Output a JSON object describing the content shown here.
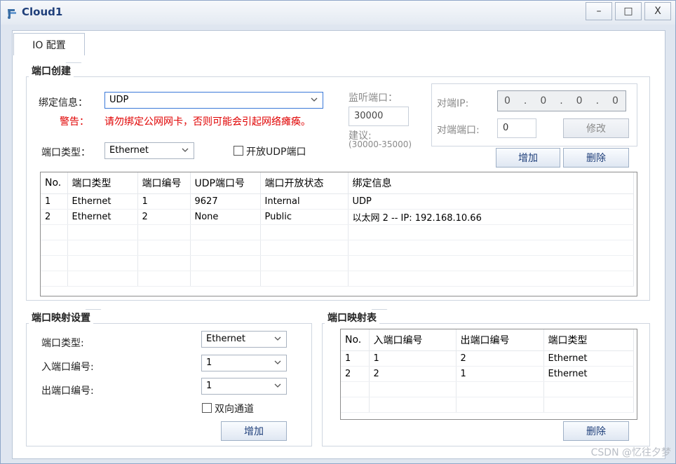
{
  "window": {
    "title": "Cloud1",
    "minimize_glyph": "–",
    "maximize_glyph": "□",
    "close_glyph": "X"
  },
  "tab": {
    "label": "IO 配置"
  },
  "create": {
    "title": "端口创建",
    "bind_label": "绑定信息：",
    "bind_value": "UDP",
    "warning_label": "警告：",
    "warning_text": "请勿绑定公网网卡，否则可能会引起网络瘫痪。",
    "port_type_label": "端口类型：",
    "port_type_value": "Ethernet",
    "open_udp_label": "开放UDP端口",
    "listen_label": "监听端口：",
    "listen_value": "30000",
    "suggest_label": "建议:",
    "suggest_range": "(30000-35000)",
    "peer_ip_label": "对端IP:",
    "peer_ip_octets": [
      "0",
      "0",
      "0",
      "0"
    ],
    "peer_port_label": "对端端口:",
    "peer_port_value": "0",
    "modify_label": "修改",
    "add_label": "增加",
    "delete_label": "删除",
    "table": {
      "headers": [
        "No.",
        "端口类型",
        "端口编号",
        "UDP端口号",
        "端口开放状态",
        "绑定信息"
      ],
      "rows": [
        [
          "1",
          "Ethernet",
          "1",
          "9627",
          "Internal",
          "UDP"
        ],
        [
          "2",
          "Ethernet",
          "2",
          "None",
          "Public",
          "以太网 2 -- IP: 192.168.10.66"
        ]
      ]
    }
  },
  "mapping": {
    "title": "端口映射设置",
    "port_type_label": "端口类型:",
    "port_type_value": "Ethernet",
    "in_label": "入端口编号:",
    "in_value": "1",
    "out_label": "出端口编号:",
    "out_value": "1",
    "bidir_label": "双向通道",
    "add_label": "增加"
  },
  "map_table": {
    "title": "端口映射表",
    "headers": [
      "No.",
      "入端口编号",
      "出端口编号",
      "端口类型"
    ],
    "rows": [
      [
        "1",
        "1",
        "2",
        "Ethernet"
      ],
      [
        "2",
        "2",
        "1",
        "Ethernet"
      ]
    ],
    "delete_label": "删除"
  },
  "watermark": "CSDN @忆往夕梦",
  "icons": [
    "cloud-app-icon",
    "minimize-icon",
    "maximize-icon",
    "close-icon",
    "chevron-down-icon",
    "checkbox-icon"
  ]
}
